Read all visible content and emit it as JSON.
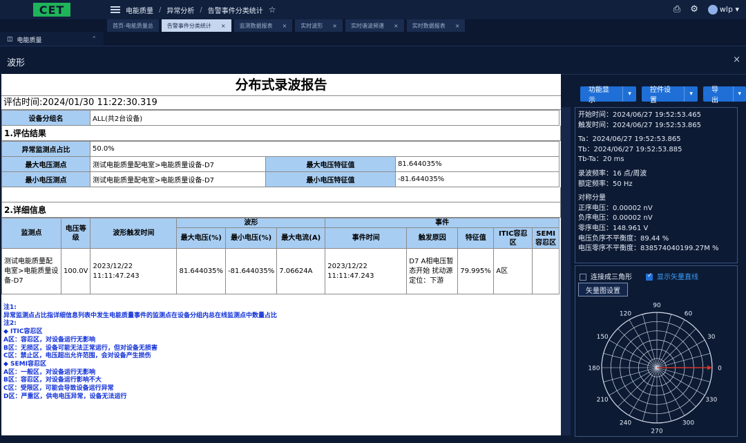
{
  "app": {
    "logo_text": "CET",
    "breadcrumb": [
      "电能质量",
      "异常分析",
      "告警事件分类统计"
    ],
    "user": "wlp",
    "tabs": [
      {
        "label": "首页-电能质量总",
        "active": false
      },
      {
        "label": "告警事件分类统计",
        "active": true
      },
      {
        "label": "监测数据报表",
        "active": false
      },
      {
        "label": "实时波形",
        "active": false
      },
      {
        "label": "实时谐波频谱",
        "active": false
      },
      {
        "label": "实时数据报表",
        "active": false
      }
    ],
    "sidebar_top": "电能质量"
  },
  "modal": {
    "title": "波形",
    "close": "×"
  },
  "report": {
    "title": "分布式录波报告",
    "eval_time": "评估时间:2024/01/30 11:22:30.319",
    "group_label": "设备分组名",
    "group_value": "ALL(共2台设备)",
    "section1": "1.评估结果",
    "abn_label": "异常监测点占比",
    "abn_value": "50.0%",
    "max_point_label": "最大电压测点",
    "max_point_value": "测试电能质量配电室>电能质量设备-D7",
    "max_feat_label": "最大电压特征值",
    "max_feat_value": "81.644035%",
    "min_point_label": "最小电压测点",
    "min_point_value": "测试电能质量配电室>电能质量设备-D7",
    "min_feat_label": "最小电压特征值",
    "min_feat_value": "-81.644035%",
    "section2": "2.详细信息",
    "headers": {
      "point": "监测点",
      "level": "电压等级",
      "trigger_time": "波形触发时间",
      "wave": "波形",
      "event": "事件",
      "max_v": "最大电压(%)",
      "min_v": "最小电压(%)",
      "max_i": "最大电流(A)",
      "event_time": "事件时间",
      "cause": "触发原因",
      "feature": "特征值",
      "itic": "ITIC容忍区",
      "semi": "SEMI容忍区"
    },
    "row": {
      "point": "测试电能质量配电室>电能质量设备-D7",
      "level": "100.0V",
      "trigger_time": "2023/12/22 11:11:47.243",
      "max_v": "81.644035%",
      "min_v": "-81.644035%",
      "max_i": "7.06624A",
      "event_time": "2023/12/22 11:11:47.243",
      "cause": "D7 A相电压暂态开始 扰动源定位：下游",
      "feature": "79.995%",
      "itic": "A区",
      "semi": ""
    },
    "notes": [
      "注1:",
      "异常监测点占比指详细信息列表中发生电能质量事件的监测点在设备分组内总在线监测点中数量占比",
      "注2:",
      "◆ ITIC容忍区",
      "A区：容忍区，对设备运行无影响",
      "B区：无损区，设备可能无法正常运行，但对设备无损害",
      "C区：禁止区，电压超出允许范围，会对设备产生损伤",
      "◆ SEMI容忍区",
      "A区：一般区，对设备运行无影响",
      "B区：容忍区，对设备运行影响不大",
      "C区：受限区，可能会导致设备运行异常",
      "D区：严重区，供电电压异常，设备无法运行"
    ]
  },
  "panel": {
    "buttons": [
      "功能显示",
      "控件设置",
      "导出"
    ],
    "info": {
      "start_time": "开始时间：2024/06/27 19:52:53.465",
      "trigger_time": "触发时间：2024/06/27 19:52:53.865",
      "ta": "Ta：2024/06/27 19:52:53.865",
      "tb": "Tb：2024/06/27 19:52:53.885",
      "tb_ta": "Tb-Ta：20 ms",
      "sample_rate": "录波频率：16 点/周波",
      "rated_freq": "额定频率：50 Hz",
      "sym_title": "对称分量",
      "pos_v": "正序电压：0.00002 nV",
      "neg_v": "负序电压：0.00002 nV",
      "zero_v": "零序电压：148.961 V",
      "neg_unbal": "电压负序不平衡度：89.44 %",
      "zero_unbal": "电压零序不平衡度：838574040199.27M %"
    },
    "chk_triangle": "连接成三角形",
    "chk_vector": "显示矢量直线",
    "vector_settings": "矢量图设置",
    "polar_labels": [
      "0",
      "30",
      "60",
      "90",
      "120",
      "150",
      "180",
      "210",
      "240",
      "270",
      "300",
      "330"
    ],
    "vector_color": "#d0362c"
  }
}
